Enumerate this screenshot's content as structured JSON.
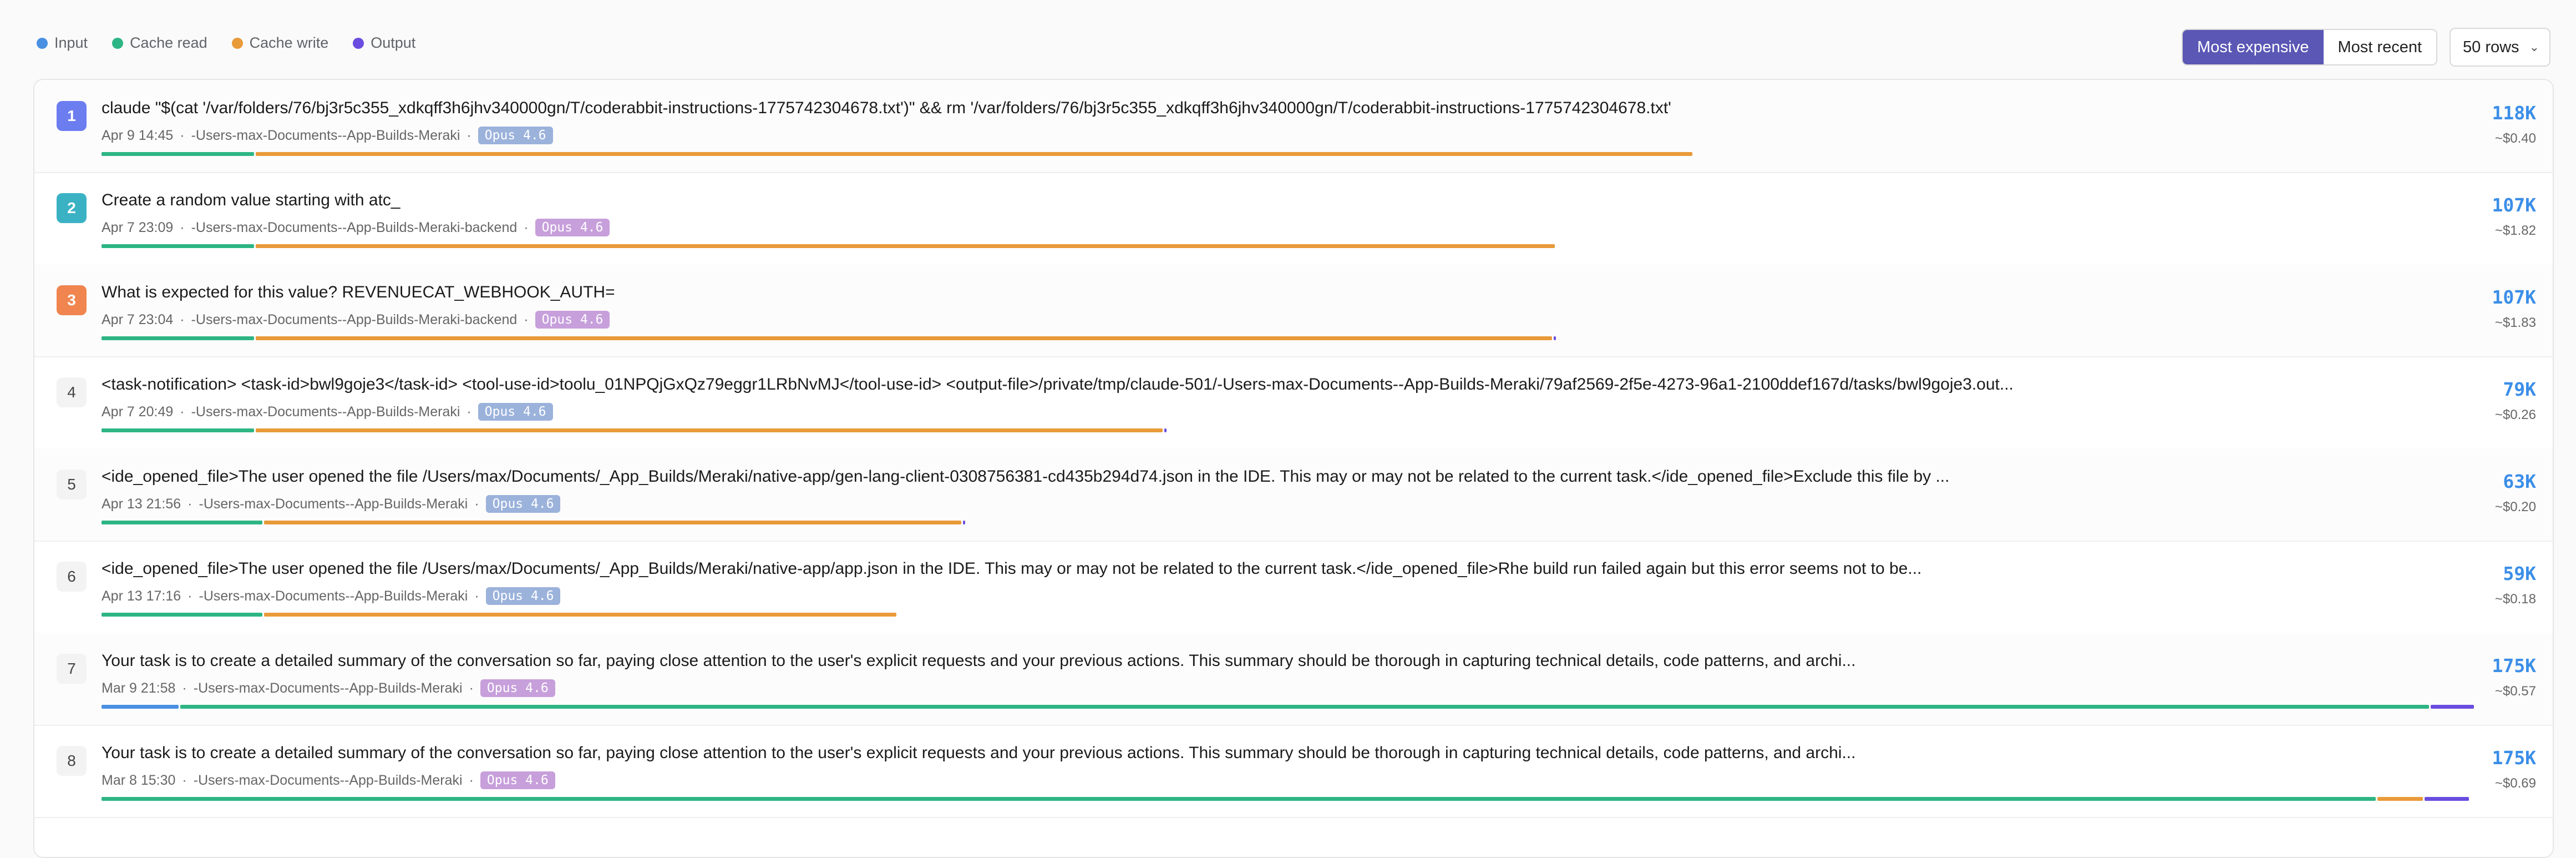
{
  "legend": [
    {
      "label": "Input",
      "color": "#4a90e2"
    },
    {
      "label": "Cache read",
      "color": "#2db584"
    },
    {
      "label": "Cache write",
      "color": "#e99a39"
    },
    {
      "label": "Output",
      "color": "#6a4ce0"
    }
  ],
  "controls": {
    "sort_expensive": "Most expensive",
    "sort_recent": "Most recent",
    "rows_value": "50 rows"
  },
  "rows": [
    {
      "index": "1",
      "badge_color": "#6c7df0",
      "title": "claude \"$(cat '/var/folders/76/bj3r5c355_xdkqff3h6jhv340000gn/T/coderabbit-instructions-1775742304678.txt')\" && rm '/var/folders/76/bj3r5c355_xdkqff3h6jhv340000gn/T/coderabbit-instructions-1775742304678.txt'",
      "date": "Apr 9 14:45",
      "project": "-Users-max-Documents--App-Builds-Meraki",
      "model": "Opus 4.6",
      "model_style": "blue",
      "tokens": "118K",
      "cost": "~$0.40",
      "segments": [
        {
          "color": "#2db584",
          "value": 275
        },
        {
          "color": "#e99a39",
          "value": 2590
        }
      ]
    },
    {
      "index": "2",
      "badge_color": "#3bb2c4",
      "title": "Create a random value starting with atc_",
      "date": "Apr 7 23:09",
      "project": "-Users-max-Documents--App-Builds-Meraki-backend",
      "model": "Opus 4.6",
      "model_style": "purple",
      "tokens": "107K",
      "cost": "~$1.82",
      "segments": [
        {
          "color": "#2db584",
          "value": 275
        },
        {
          "color": "#e99a39",
          "value": 2342
        }
      ]
    },
    {
      "index": "3",
      "badge_color": "#f0854f",
      "title": "What is expected for this value? REVENUECAT_WEBHOOK_AUTH=",
      "date": "Apr 7 23:04",
      "project": "-Users-max-Documents--App-Builds-Meraki-backend",
      "model": "Opus 4.6",
      "model_style": "purple",
      "tokens": "107K",
      "cost": "~$1.83",
      "segments": [
        {
          "color": "#2db584",
          "value": 275
        },
        {
          "color": "#e99a39",
          "value": 2337
        },
        {
          "color": "#6a4ce0",
          "value": 4
        }
      ]
    },
    {
      "index": "4",
      "badge_color": "",
      "title": "<task-notification> <task-id>bwl9goje3</task-id> <tool-use-id>toolu_01NPQjGxQz79eggr1LRbNvMJ</tool-use-id> <output-file>/private/tmp/claude-501/-Users-max-Documents--App-Builds-Meraki/79af2569-2f5e-4273-96a1-2100ddef167d/tasks/bwl9goje3.out...",
      "date": "Apr 7 20:49",
      "project": "-Users-max-Documents--App-Builds-Meraki",
      "model": "Opus 4.6",
      "model_style": "blue",
      "tokens": "79K",
      "cost": "~$0.26",
      "segments": [
        {
          "color": "#2db584",
          "value": 275
        },
        {
          "color": "#e99a39",
          "value": 1635
        },
        {
          "color": "#6a4ce0",
          "value": 4
        }
      ]
    },
    {
      "index": "5",
      "badge_color": "",
      "title": "<ide_opened_file>The user opened the file /Users/max/Documents/_App_Builds/Meraki/native-app/gen-lang-client-0308756381-cd435b294d74.json in the IDE. This may or may not be related to the current task.</ide_opened_file>Exclude this file by ...",
      "date": "Apr 13 21:56",
      "project": "-Users-max-Documents--App-Builds-Meraki",
      "model": "Opus 4.6",
      "model_style": "blue",
      "tokens": "63K",
      "cost": "~$0.20",
      "segments": [
        {
          "color": "#2db584",
          "value": 290
        },
        {
          "color": "#e99a39",
          "value": 1257
        },
        {
          "color": "#6a4ce0",
          "value": 4
        }
      ]
    },
    {
      "index": "6",
      "badge_color": "",
      "title": "<ide_opened_file>The user opened the file /Users/max/Documents/_App_Builds/Meraki/native-app/app.json in the IDE. This may or may not be related to the current task.</ide_opened_file>Rhe build run failed again but this error seems not to be...",
      "date": "Apr 13 17:16",
      "project": "-Users-max-Documents--App-Builds-Meraki",
      "model": "Opus 4.6",
      "model_style": "blue",
      "tokens": "59K",
      "cost": "~$0.18",
      "segments": [
        {
          "color": "#2db584",
          "value": 290
        },
        {
          "color": "#e99a39",
          "value": 1140
        }
      ]
    },
    {
      "index": "7",
      "badge_color": "",
      "title": "Your task is to create a detailed summary of the conversation so far, paying close attention to the user's explicit requests and your previous actions. This summary should be thorough in capturing technical details, code patterns, and archi...",
      "date": "Mar 9 21:58",
      "project": "-Users-max-Documents--App-Builds-Meraki",
      "model": "Opus 4.6",
      "model_style": "purple",
      "tokens": "175K",
      "cost": "~$0.57",
      "segments": [
        {
          "color": "#4a90e2",
          "value": 139
        },
        {
          "color": "#2db584",
          "value": 4054
        },
        {
          "color": "#6a4ce0",
          "value": 78
        }
      ]
    },
    {
      "index": "8",
      "badge_color": "",
      "title": "Your task is to create a detailed summary of the conversation so far, paying close attention to the user's explicit requests and your previous actions. This summary should be thorough in capturing technical details, code patterns, and archi...",
      "date": "Mar 8 15:30",
      "project": "-Users-max-Documents--App-Builds-Meraki",
      "model": "Opus 4.6",
      "model_style": "purple",
      "tokens": "175K",
      "cost": "~$0.69",
      "segments": [
        {
          "color": "#2db584",
          "value": 4100
        },
        {
          "color": "#e99a39",
          "value": 82
        },
        {
          "color": "#6a4ce0",
          "value": 80
        }
      ]
    }
  ]
}
